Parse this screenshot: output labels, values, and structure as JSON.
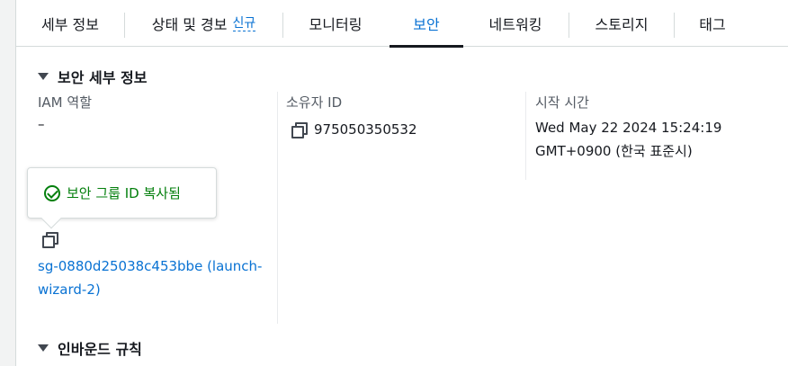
{
  "tabs": [
    {
      "label": "세부 정보"
    },
    {
      "label": "상태 및 경보",
      "badge": "신규"
    },
    {
      "label": "모니터링"
    },
    {
      "label": "보안",
      "active": true
    },
    {
      "label": "네트워킹"
    },
    {
      "label": "스토리지"
    },
    {
      "label": "태그"
    }
  ],
  "security_details": {
    "title": "보안 세부 정보",
    "iam_role": {
      "label": "IAM 역할",
      "value": "–"
    },
    "owner_id": {
      "label": "소유자 ID",
      "value": "975050350532"
    },
    "launch_time": {
      "label": "시작 시간",
      "value_line1": "Wed May 22 2024 15:24:19",
      "value_line2": "GMT+0900 (한국 표준시)"
    },
    "popover": {
      "text": "보안 그룹 ID 복사됨",
      "icon": "check-circle-icon"
    },
    "security_group": {
      "link_line1": "sg-0880d25038c453bbe (launch-",
      "link_line2": "wizard-2)"
    }
  },
  "inbound_rules": {
    "title": "인바운드 규칙"
  },
  "colors": {
    "link": "#0972d3",
    "success": "#037f0c",
    "text": "#16191f",
    "label": "#545b64"
  }
}
